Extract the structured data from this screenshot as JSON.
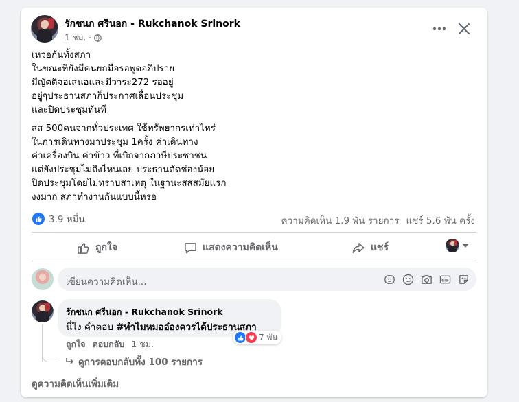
{
  "post": {
    "author": "รักชนก ศรีนอก - Rukchanok Srinork",
    "time": "1 ชม. ·",
    "paragraph1": [
      "เหวอกันทั้งสภา",
      "ในขณะที่ยังมีคนยกมือรอพูดอภิปราย",
      "มีญัตติจอเสนอและมีวาระ272 รออยู่",
      "อยู่ๆประธานสภาก็ประกาศเลื่อนประชุม",
      "และปิดประชุมทันที"
    ],
    "paragraph2": [
      "สส 500คนจากทั่วประเทศ ใช้ทรัพยากรเท่าไหร่",
      "ในการเดินทางมาประชุม 1ครั้ง ค่าเดินทาง",
      "ค่าเครื่องบิน ค่าข้าว ที่เบิกจากภาษีประชาชน",
      "แต่ยังประชุมไม่ถึงไหนเลย ประธานตัดช่องน้อย",
      "ปิดประชุมโดยไม่ทราบสาเหตุ ในฐานะสสสมัยแรก",
      "งงมาก สภาทำงานกันแบบนี้หรอ"
    ],
    "reaction_count": "3.9 หมื่น",
    "comments_count": "ความคิดเห็น 1.9 พัน รายการ",
    "shares_count": "แชร์ 5.6 พัน ครั้ง"
  },
  "actions": {
    "like": "ถูกใจ",
    "comment": "แสดงความคิดเห็น",
    "share": "แชร์"
  },
  "composer": {
    "placeholder": "เขียนความคิดเห็น..."
  },
  "comment": {
    "author": "รักชนก ศรีนอก - Rukchanok Srinork",
    "text_prefix": "นี่ไง คำตอบ ",
    "hashtag": "#ทำไมหมออ๋องควรได้ประธานสภา",
    "reaction_count": "7 พัน",
    "like": "ถูกใจ",
    "reply": "ตอบกลับ",
    "time": "1 ชม."
  },
  "view_replies": "ดูการตอบกลับทั้ง 100 รายการ",
  "more_comments": "ดูความคิดเห็นเพิ่มเติม",
  "colors": {
    "accent": "#2078f4",
    "love": "#f33e58",
    "secondary_text": "#65676b"
  }
}
